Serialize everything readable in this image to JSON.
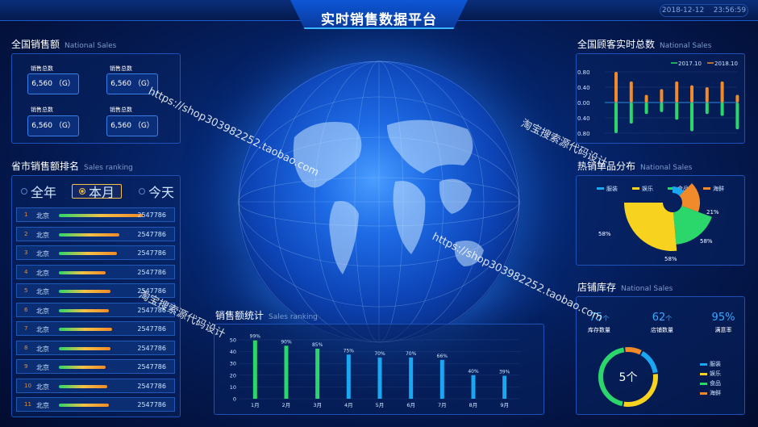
{
  "header": {
    "title": "实时销售数据平台",
    "date": "2018-12-12",
    "time": "23:56:59"
  },
  "national_sales": {
    "title": "全国销售额",
    "title_en": "National Sales",
    "items": [
      {
        "label": "销售总数",
        "value": "6,560 （G）"
      },
      {
        "label": "销售总数",
        "value": "6,560 （G）"
      },
      {
        "label": "销售总数",
        "value": "6,560 （G）"
      },
      {
        "label": "销售总数",
        "value": "6,560 （G）"
      }
    ]
  },
  "ranking": {
    "title": "省市销售额排名",
    "title_en": "Sales ranking",
    "filters": [
      "全年",
      "本月",
      "今天"
    ],
    "active_filter": "本月",
    "rows": [
      {
        "num": "1",
        "city": "北京",
        "value": "2547786",
        "level": 1.0
      },
      {
        "num": "2",
        "city": "北京",
        "value": "2547786",
        "level": 0.72
      },
      {
        "num": "3",
        "city": "北京",
        "value": "2547786",
        "level": 0.69
      },
      {
        "num": "4",
        "city": "北京",
        "value": "2547786",
        "level": 0.56
      },
      {
        "num": "5",
        "city": "北京",
        "value": "2547786",
        "level": 0.62
      },
      {
        "num": "6",
        "city": "北京",
        "value": "2547786",
        "level": 0.6
      },
      {
        "num": "7",
        "city": "北京",
        "value": "2547786",
        "level": 0.63
      },
      {
        "num": "8",
        "city": "北京",
        "value": "2547786",
        "level": 0.62
      },
      {
        "num": "9",
        "city": "北京",
        "value": "2547786",
        "level": 0.56
      },
      {
        "num": "10",
        "city": "北京",
        "value": "2547786",
        "level": 0.58
      },
      {
        "num": "11",
        "city": "北京",
        "value": "2547786",
        "level": 0.6
      }
    ]
  },
  "customers": {
    "title": "全国顾客实时总数",
    "title_en": "National Sales"
  },
  "hot_products": {
    "title": "热销单品分布",
    "title_en": "National Sales"
  },
  "store_stock": {
    "title": "店铺库存",
    "title_en": "National Sales",
    "stats": [
      {
        "value": "75",
        "unit": "个",
        "label": "库存数量"
      },
      {
        "value": "62",
        "unit": "个",
        "label": "店铺数量"
      },
      {
        "value": "95%",
        "unit": "",
        "label": "满意率"
      }
    ],
    "center_label": "5个",
    "legend": [
      "服装",
      "娱乐",
      "食品",
      "海鲜"
    ]
  },
  "sales_stats": {
    "title": "销售额统计",
    "title_en": "Sales ranking"
  },
  "watermarks": [
    "https://shop303982252.taobao.com",
    "淘宝搜索源代码设计",
    "https://shop303982252.taobao.com",
    "淘宝搜索源代码设计"
  ],
  "colors": {
    "green": "#2bd66a",
    "orange": "#f08a2a",
    "yellow": "#f7d21e",
    "blue": "#1aa6f0",
    "accent": "#38b6ff"
  },
  "chart_data": [
    {
      "type": "bar",
      "name": "customers",
      "series": [
        {
          "name": "2017.10",
          "values": [
            -0.8,
            -0.55,
            -0.3,
            -0.25,
            -0.45,
            -0.75,
            -0.3,
            -0.35,
            -0.7
          ]
        },
        {
          "name": "2018.10",
          "values": [
            0.8,
            0.55,
            0.2,
            0.35,
            0.55,
            0.45,
            0.4,
            0.55,
            0.2
          ]
        }
      ],
      "y_tick_labels": [
        "0.80",
        "0.40",
        "0.00",
        "0.40",
        "0.80"
      ],
      "ylim": [
        -0.9,
        0.9
      ],
      "legend_position": "top-right"
    },
    {
      "type": "pie",
      "name": "hot_products",
      "legend": [
        "服装",
        "娱乐",
        "食品",
        "海鲜"
      ],
      "slices": [
        {
          "label": "服装",
          "value": 21,
          "display": "21%",
          "color": "#1aa6f0"
        },
        {
          "label": "海鲜",
          "value": 58,
          "display": "58%",
          "color": "#f08a2a"
        },
        {
          "label": "食品",
          "value": 58,
          "display": "58%",
          "color": "#2bd66a"
        },
        {
          "label": "娱乐",
          "value": 58,
          "display": "58%",
          "color": "#f7d21e"
        }
      ]
    },
    {
      "type": "bar",
      "name": "sales_stats",
      "categories": [
        "1月",
        "2月",
        "3月",
        "4月",
        "5月",
        "6月",
        "7月",
        "8月",
        "9月"
      ],
      "values": [
        99,
        90,
        85,
        75,
        70,
        70,
        66,
        40,
        39
      ],
      "value_labels": [
        "99%",
        "90%",
        "85%",
        "75%",
        "70%",
        "70%",
        "66%",
        "40%",
        "39%"
      ],
      "y_ticks": [
        0,
        10,
        20,
        30,
        40,
        50
      ],
      "ylim": [
        0,
        50
      ]
    },
    {
      "type": "pie",
      "name": "store_ring",
      "slices": [
        {
          "label": "服装",
          "value": 15,
          "color": "#1aa6f0"
        },
        {
          "label": "娱乐",
          "value": 30,
          "color": "#f7d21e"
        },
        {
          "label": "食品",
          "value": 45,
          "color": "#2bd66a"
        },
        {
          "label": "海鲜",
          "value": 10,
          "color": "#f08a2a"
        }
      ]
    }
  ]
}
